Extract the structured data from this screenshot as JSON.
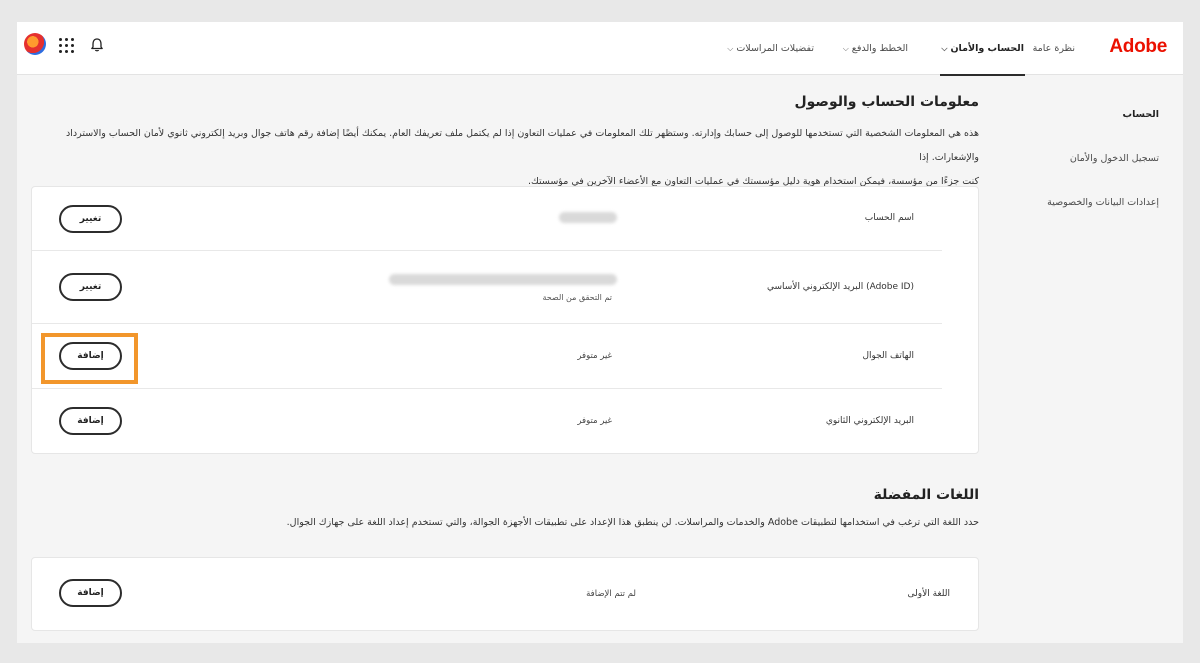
{
  "header": {
    "logo": "Adobe",
    "nav": [
      {
        "label": "نظرة عامة"
      },
      {
        "label": "الحساب والأمان"
      },
      {
        "label": "الخطط والدفع"
      },
      {
        "label": "تفضيلات المراسلات"
      }
    ],
    "icons": [
      "user-avatar",
      "apps-grid-icon",
      "bell-icon"
    ]
  },
  "sidebar": {
    "items": [
      {
        "label": "الحساب"
      },
      {
        "label": "تسجيل الدخول والأمان"
      },
      {
        "label": "إعدادات البيانات والخصوصية"
      }
    ]
  },
  "account_section": {
    "title": "معلومات الحساب والوصول",
    "description_line1": "هذه هي المعلومات الشخصية التي تستخدمها للوصول إلى حسابك وإدارته. وستظهر تلك المعلومات في عمليات التعاون إذا لم يكتمل ملف تعريفك العام. يمكنك أيضًا إضافة رقم هاتف جوال وبريد إلكتروني ثانوي لأمان الحساب والاسترداد والإشعارات. إذا",
    "description_line2": "كنت جزءًا من مؤسسة، فيمكن استخدام هوية دليل مؤسستك في عمليات التعاون مع الأعضاء الآخرين في مؤسستك.",
    "rows": [
      {
        "label": "اسم الحساب",
        "value": "",
        "sub": "",
        "button": "تغيير"
      },
      {
        "label": "البريد الإلكتروني الأساسي (Adobe ID)",
        "value": "",
        "sub": "تم التحقق من الصحة",
        "button": "تغيير"
      },
      {
        "label": "الهاتف الجوال",
        "value": "غير متوفر",
        "sub": "",
        "button": "إضافة"
      },
      {
        "label": "البريد الإلكتروني الثانوي",
        "value": "غير متوفر",
        "sub": "",
        "button": "إضافة"
      }
    ]
  },
  "languages_section": {
    "title": "اللغات المفضلة",
    "description": "حدد اللغة التي ترغب في استخدامها لتطبيقات Adobe والخدمات والمراسلات. لن ينطبق هذا الإعداد على تطبيقات الأجهزة الجوالة، والتي تستخدم إعداد اللغة على جهازك الجوال.",
    "rows": [
      {
        "label": "اللغة الأولى",
        "value": "لم تتم الإضافة",
        "button": "إضافة"
      }
    ]
  },
  "colors": {
    "brand": "#eb1000",
    "highlight": "#f2962b"
  }
}
